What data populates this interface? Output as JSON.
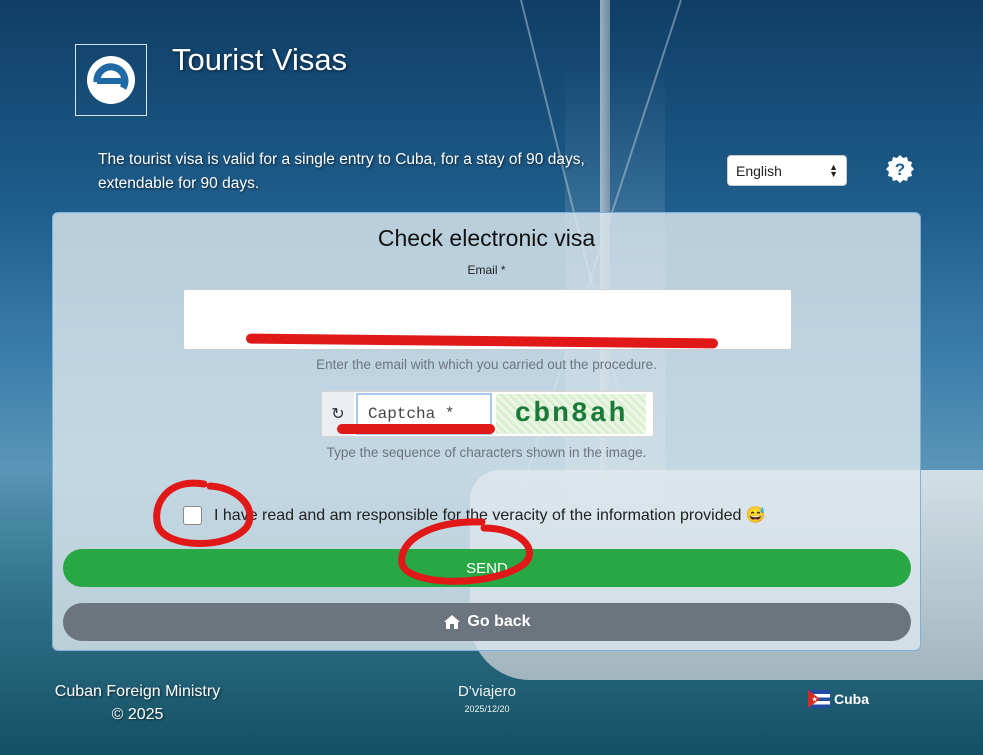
{
  "header": {
    "title": "Tourist Visas",
    "intro": "The tourist visa is valid for a single entry to Cuba, for a stay of 90 days, extendable for 90 days.",
    "language_selected": "English",
    "icons": {
      "logo": "e-logo-icon",
      "help": "help-question-icon"
    }
  },
  "form": {
    "title": "Check electronic visa",
    "email_label": "Email *",
    "email_value": "",
    "email_help": "Enter the email with which you carried out the procedure.",
    "captcha_placeholder": "Captcha *",
    "captcha_image_text": "cbn8ah",
    "captcha_help": "Type the sequence of characters shown in the image.",
    "consent_text": "I have read and am responsible for the veracity of the information provided 😅",
    "consent_checked": false,
    "send_label": "SEND",
    "back_label": "Go back",
    "icons": {
      "refresh": "refresh-icon",
      "home": "home-icon"
    }
  },
  "footer": {
    "ministry": "Cuban Foreign Ministry",
    "copyright": "© 2025",
    "brand": "D'viajero",
    "date": "2025/12/20",
    "country": "Cuba",
    "icons": {
      "flag": "cuba-flag-icon"
    }
  },
  "colors": {
    "send": "#28a745",
    "back": "#6c757d",
    "annotation": "#e01818"
  }
}
